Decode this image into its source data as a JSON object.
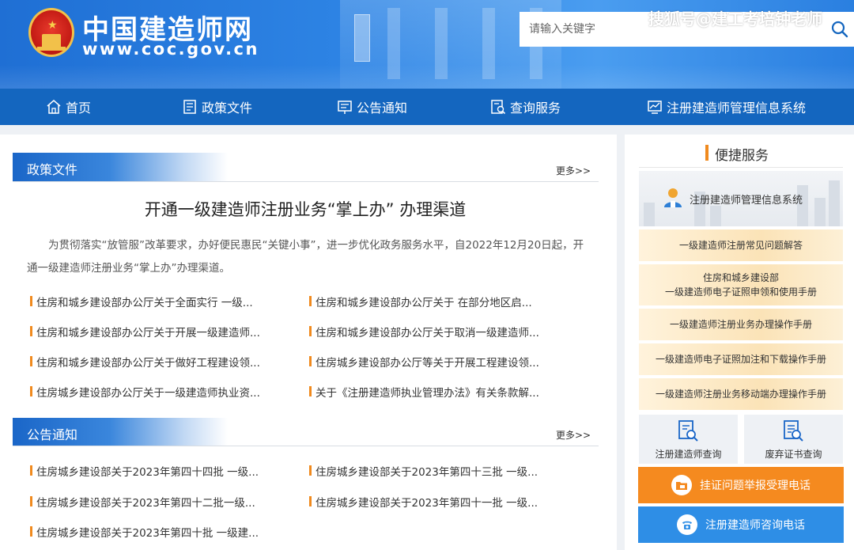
{
  "header": {
    "site_title": "中国建造师网",
    "site_url": "www.coc.gov.cn",
    "search_placeholder": "请输入关键字",
    "watermark": "搜狐号@建工考培钟老师"
  },
  "nav": {
    "items": [
      {
        "label": "首页",
        "icon": "home-icon"
      },
      {
        "label": "政策文件",
        "icon": "document-icon"
      },
      {
        "label": "公告通知",
        "icon": "announcement-icon"
      },
      {
        "label": "查询服务",
        "icon": "query-icon"
      },
      {
        "label": "注册建造师管理信息系统",
        "icon": "chart-icon"
      }
    ]
  },
  "policy": {
    "title": "政策文件",
    "more": "更多>>",
    "headline": "开通一级建造师注册业务“掌上办” 办理渠道",
    "summary": "为贯彻落实“放管服”改革要求，办好便民惠民“关键小事”，进一步优化政务服务水平，自2022年12月20日起，开通一级建造师注册业务“掌上办”办理渠道。",
    "links": [
      "住房和城乡建设部办公厅关于全面实行 一级...",
      "住房和城乡建设部办公厅关于 在部分地区启...",
      "住房和城乡建设部办公厅关于开展一级建造师...",
      "住房和城乡建设部办公厅关于取消一级建造师...",
      "住房和城乡建设部办公厅关于做好工程建设领...",
      "住房城乡建设部办公厅等关于开展工程建设领...",
      "住房城乡建设部办公厅关于一级建造师执业资...",
      "关于《注册建造师执业管理办法》有关条款解..."
    ]
  },
  "notice": {
    "title": "公告通知",
    "more": "更多>>",
    "links": [
      "住房城乡建设部关于2023年第四十四批 一级...",
      "住房城乡建设部关于2023年第四十三批 一级...",
      "住房城乡建设部关于2023年第四十二批一级...",
      "住房城乡建设部关于2023年第四十一批 一级...",
      "住房城乡建设部关于2023年第四十批 一级建..."
    ]
  },
  "sidebar": {
    "title": "便捷服务",
    "system_card": "注册建造师管理信息系统",
    "manuals": [
      {
        "line1": "一级建造师注册常见问题解答"
      },
      {
        "line1": "住房和城乡建设部",
        "line2": "一级建造师电子证照申领和使用手册"
      },
      {
        "line1": "一级建造师注册业务办理操作手册"
      },
      {
        "line1": "一级建造师电子证照加注和下载操作手册"
      },
      {
        "line1": "一级建造师注册业务移动端办理操作手册"
      }
    ],
    "query_builder": "注册建造师查询",
    "query_abandoned": "废弃证书查询",
    "report_phone": "挂证问题举报受理电话",
    "consult_phone": "注册建造师咨询电话"
  },
  "colors": {
    "header_blue": "#2a7fe0",
    "nav_blue": "#1466bf",
    "accent_orange": "#f08a1e",
    "button_blue": "#2e8ee6"
  }
}
